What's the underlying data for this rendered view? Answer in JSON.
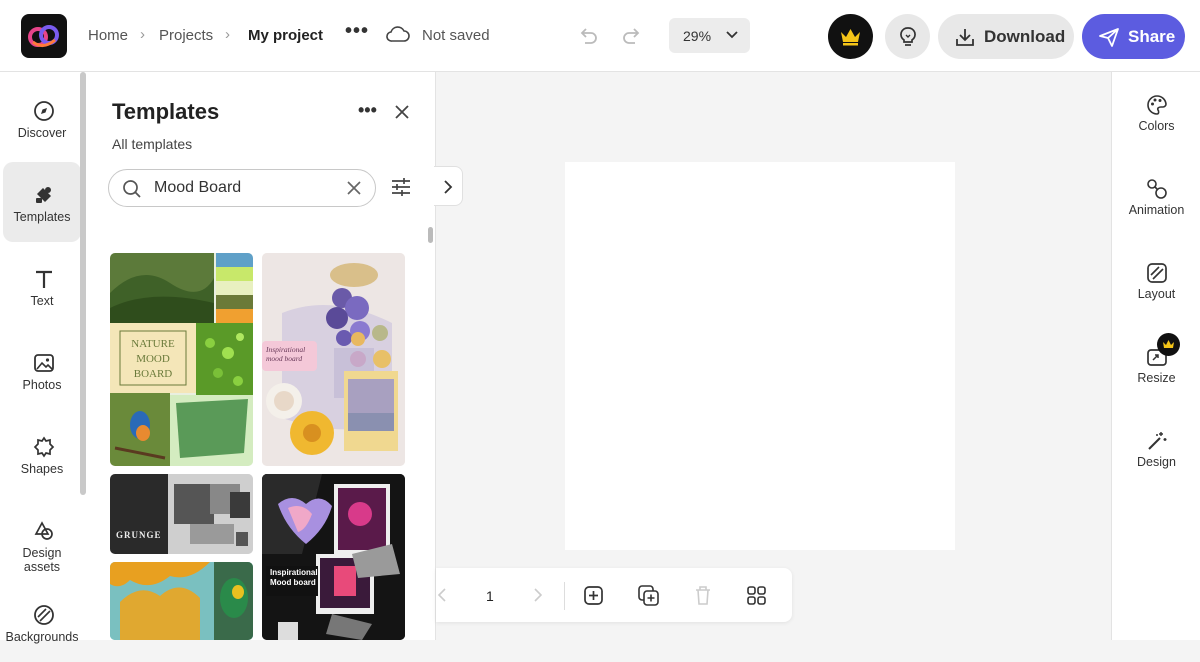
{
  "header": {
    "breadcrumb": [
      "Home",
      "Projects",
      "My project"
    ],
    "save_status": "Not saved",
    "zoom": "29%",
    "download_label": "Download",
    "share_label": "Share"
  },
  "left_rail": {
    "items": [
      {
        "label": "Discover",
        "icon": "compass-icon"
      },
      {
        "label": "Templates",
        "icon": "templates-icon",
        "active": true
      },
      {
        "label": "Text",
        "icon": "text-icon"
      },
      {
        "label": "Photos",
        "icon": "photo-icon"
      },
      {
        "label": "Shapes",
        "icon": "shapes-icon"
      },
      {
        "label": "Design assets",
        "icon": "design-assets-icon"
      },
      {
        "label": "Backgrounds",
        "icon": "backgrounds-icon"
      }
    ]
  },
  "panel": {
    "title": "Templates",
    "subtitle": "All templates",
    "search_value": "Mood Board",
    "templates": [
      {
        "caption": "NATURE MOOD BOARD"
      },
      {
        "caption": "Inspirational mood board"
      },
      {
        "caption": "GRUNGE"
      },
      {
        "caption": "Inspirational Mood board"
      }
    ]
  },
  "pagebar": {
    "page_number": "1"
  },
  "right_rail": {
    "items": [
      {
        "label": "Colors",
        "icon": "palette-icon"
      },
      {
        "label": "Animation",
        "icon": "animation-icon"
      },
      {
        "label": "Layout",
        "icon": "layout-icon"
      },
      {
        "label": "Resize",
        "icon": "resize-icon"
      },
      {
        "label": "Design",
        "icon": "magic-wand-icon"
      }
    ]
  },
  "colors": {
    "accent": "#5c5ce0",
    "crown": "#f5c518"
  }
}
